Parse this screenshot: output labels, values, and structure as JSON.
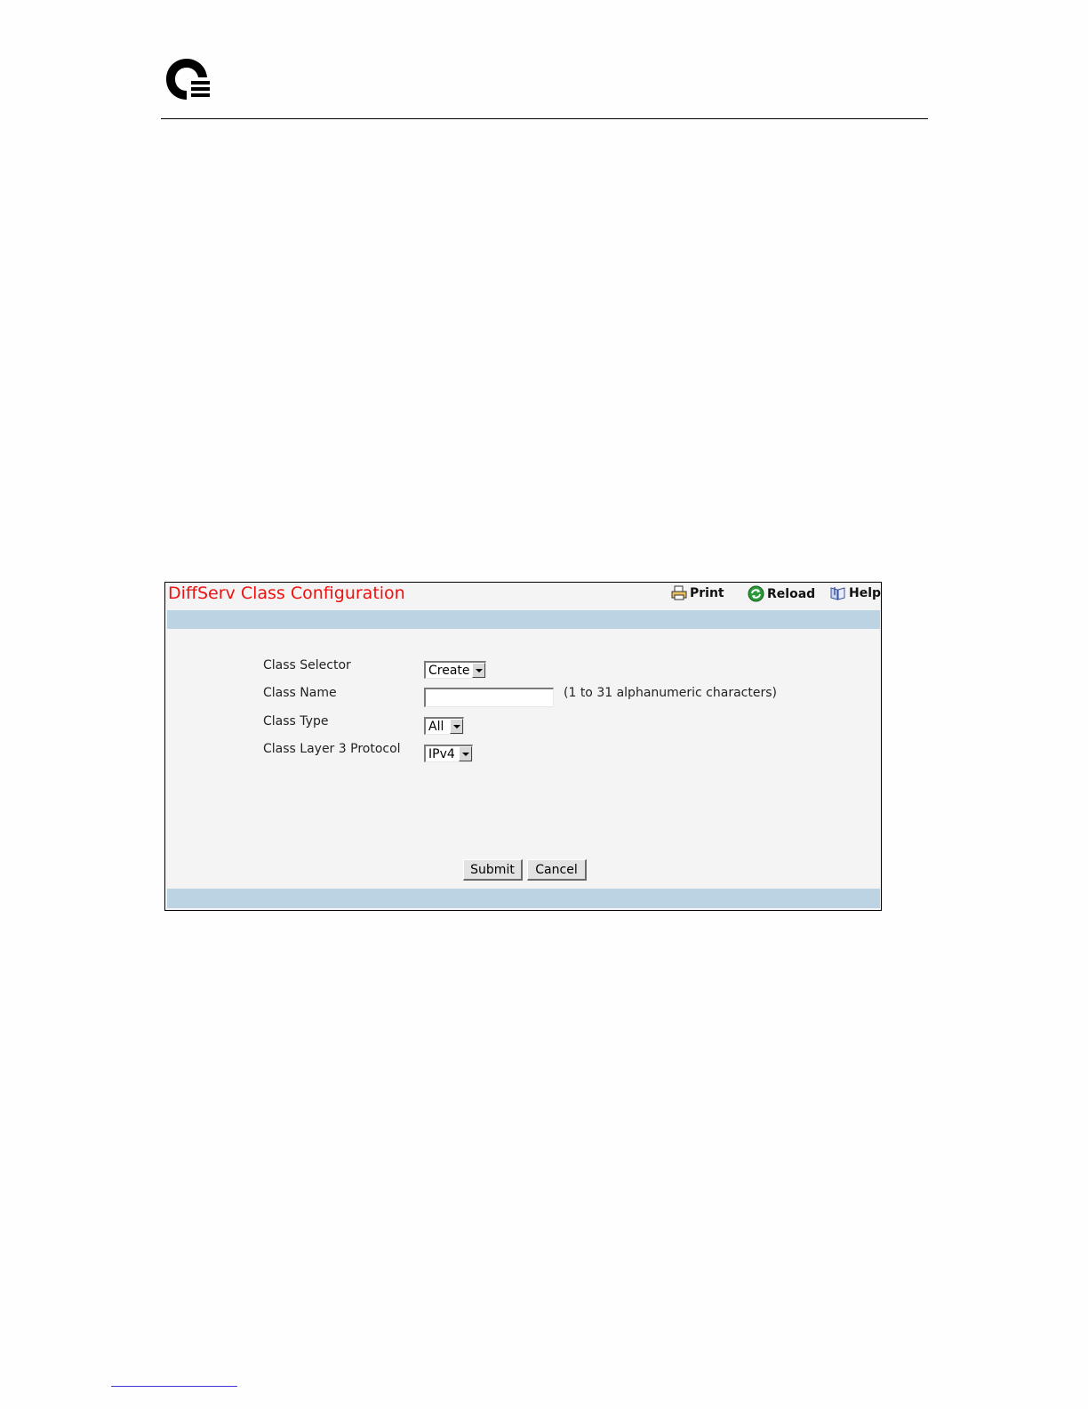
{
  "panel": {
    "title": "DiffServ Class Configuration",
    "toolbar": {
      "print_label": "Print",
      "reload_label": "Reload",
      "help_label": "Help"
    }
  },
  "form": {
    "class_selector": {
      "label": "Class Selector",
      "value": "Create"
    },
    "class_name": {
      "label": "Class Name",
      "value": "",
      "hint": "(1 to 31 alphanumeric characters)"
    },
    "class_type": {
      "label": "Class Type",
      "value": "All"
    },
    "class_layer3_protocol": {
      "label": "Class Layer 3 Protocol",
      "value": "IPv4"
    }
  },
  "actions": {
    "submit_label": "Submit",
    "cancel_label": "Cancel"
  },
  "icons": {
    "logo": "company-logo",
    "print": "printer-icon",
    "reload": "reload-icon",
    "help": "help-book-icon"
  },
  "colors": {
    "title": "#ee1111",
    "band": "#bcd3e3",
    "panel_bg": "#f4f4f4"
  }
}
